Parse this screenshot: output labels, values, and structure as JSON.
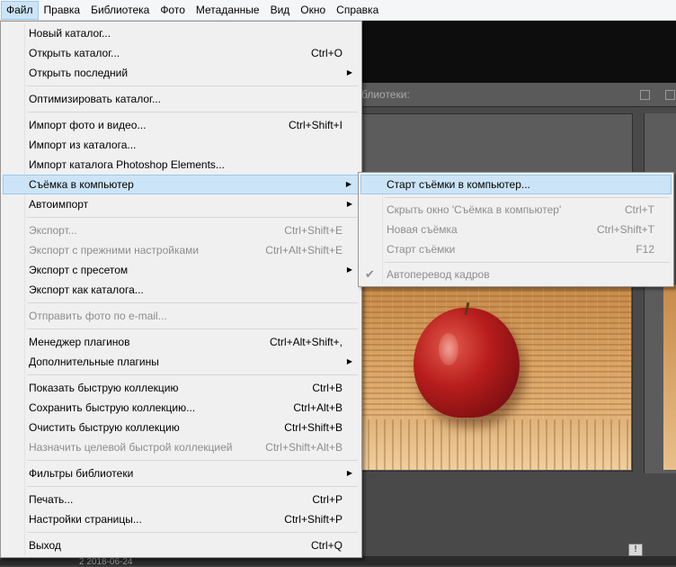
{
  "menubar": {
    "items": [
      "Файл",
      "Правка",
      "Библиотека",
      "Фото",
      "Метаданные",
      "Вид",
      "Окно",
      "Справка"
    ]
  },
  "background": {
    "panel_label": "блиотеки:",
    "filmstrip_date": "2  2018-06-24",
    "badge_text": "!"
  },
  "file_menu": {
    "items": [
      {
        "label": "Новый каталог...",
        "shortcut": "",
        "submenu": false,
        "disabled": false
      },
      {
        "label": "Открыть каталог...",
        "shortcut": "Ctrl+O",
        "submenu": false,
        "disabled": false
      },
      {
        "label": "Открыть последний",
        "shortcut": "",
        "submenu": true,
        "disabled": false
      },
      {
        "label": "Оптимизировать каталог...",
        "shortcut": "",
        "submenu": false,
        "disabled": false
      },
      {
        "label": "Импорт фото и видео...",
        "shortcut": "Ctrl+Shift+I",
        "submenu": false,
        "disabled": false
      },
      {
        "label": "Импорт из каталога...",
        "shortcut": "",
        "submenu": false,
        "disabled": false
      },
      {
        "label": "Импорт каталога Photoshop Elements...",
        "shortcut": "",
        "submenu": false,
        "disabled": false
      },
      {
        "label": "Съёмка в компьютер",
        "shortcut": "",
        "submenu": true,
        "disabled": false,
        "highlighted": true
      },
      {
        "label": "Автоимпорт",
        "shortcut": "",
        "submenu": true,
        "disabled": false
      },
      {
        "label": "Экспорт...",
        "shortcut": "Ctrl+Shift+E",
        "submenu": false,
        "disabled": true
      },
      {
        "label": "Экспорт с прежними настройками",
        "shortcut": "Ctrl+Alt+Shift+E",
        "submenu": false,
        "disabled": true
      },
      {
        "label": "Экспорт с пресетом",
        "shortcut": "",
        "submenu": true,
        "disabled": false
      },
      {
        "label": "Экспорт как каталога...",
        "shortcut": "",
        "submenu": false,
        "disabled": false
      },
      {
        "label": "Отправить фото по e-mail...",
        "shortcut": "",
        "submenu": false,
        "disabled": true
      },
      {
        "label": "Менеджер плагинов",
        "shortcut": "Ctrl+Alt+Shift+,",
        "submenu": false,
        "disabled": false
      },
      {
        "label": "Дополнительные плагины",
        "shortcut": "",
        "submenu": true,
        "disabled": false
      },
      {
        "label": "Показать быструю коллекцию",
        "shortcut": "Ctrl+B",
        "submenu": false,
        "disabled": false
      },
      {
        "label": "Сохранить быструю коллекцию...",
        "shortcut": "Ctrl+Alt+B",
        "submenu": false,
        "disabled": false
      },
      {
        "label": "Очистить быструю коллекцию",
        "shortcut": "Ctrl+Shift+B",
        "submenu": false,
        "disabled": false
      },
      {
        "label": "Назначить целевой быстрой коллекцией",
        "shortcut": "Ctrl+Shift+Alt+B",
        "submenu": false,
        "disabled": true
      },
      {
        "label": "Фильтры библиотеки",
        "shortcut": "",
        "submenu": true,
        "disabled": false
      },
      {
        "label": "Печать...",
        "shortcut": "Ctrl+P",
        "submenu": false,
        "disabled": false
      },
      {
        "label": "Настройки страницы...",
        "shortcut": "Ctrl+Shift+P",
        "submenu": false,
        "disabled": false
      },
      {
        "label": "Выход",
        "shortcut": "Ctrl+Q",
        "submenu": false,
        "disabled": false
      }
    ]
  },
  "tether_submenu": {
    "items": [
      {
        "label": "Старт съёмки в компьютер...",
        "shortcut": "",
        "disabled": false,
        "highlighted": true
      },
      {
        "label": "Скрыть окно 'Съёмка в компьютер'",
        "shortcut": "Ctrl+T",
        "disabled": true
      },
      {
        "label": "Новая съёмка",
        "shortcut": "Ctrl+Shift+T",
        "disabled": true
      },
      {
        "label": "Старт съёмки",
        "shortcut": "F12",
        "disabled": true
      },
      {
        "label": "Автоперевод кадров",
        "shortcut": "",
        "disabled": true,
        "checked": true
      }
    ]
  },
  "colors": {
    "highlight_bg": "#cce4f7",
    "highlight_border": "#99c9ef",
    "menu_bg": "#f0f0f0",
    "disabled_text": "#8d8d8d"
  }
}
